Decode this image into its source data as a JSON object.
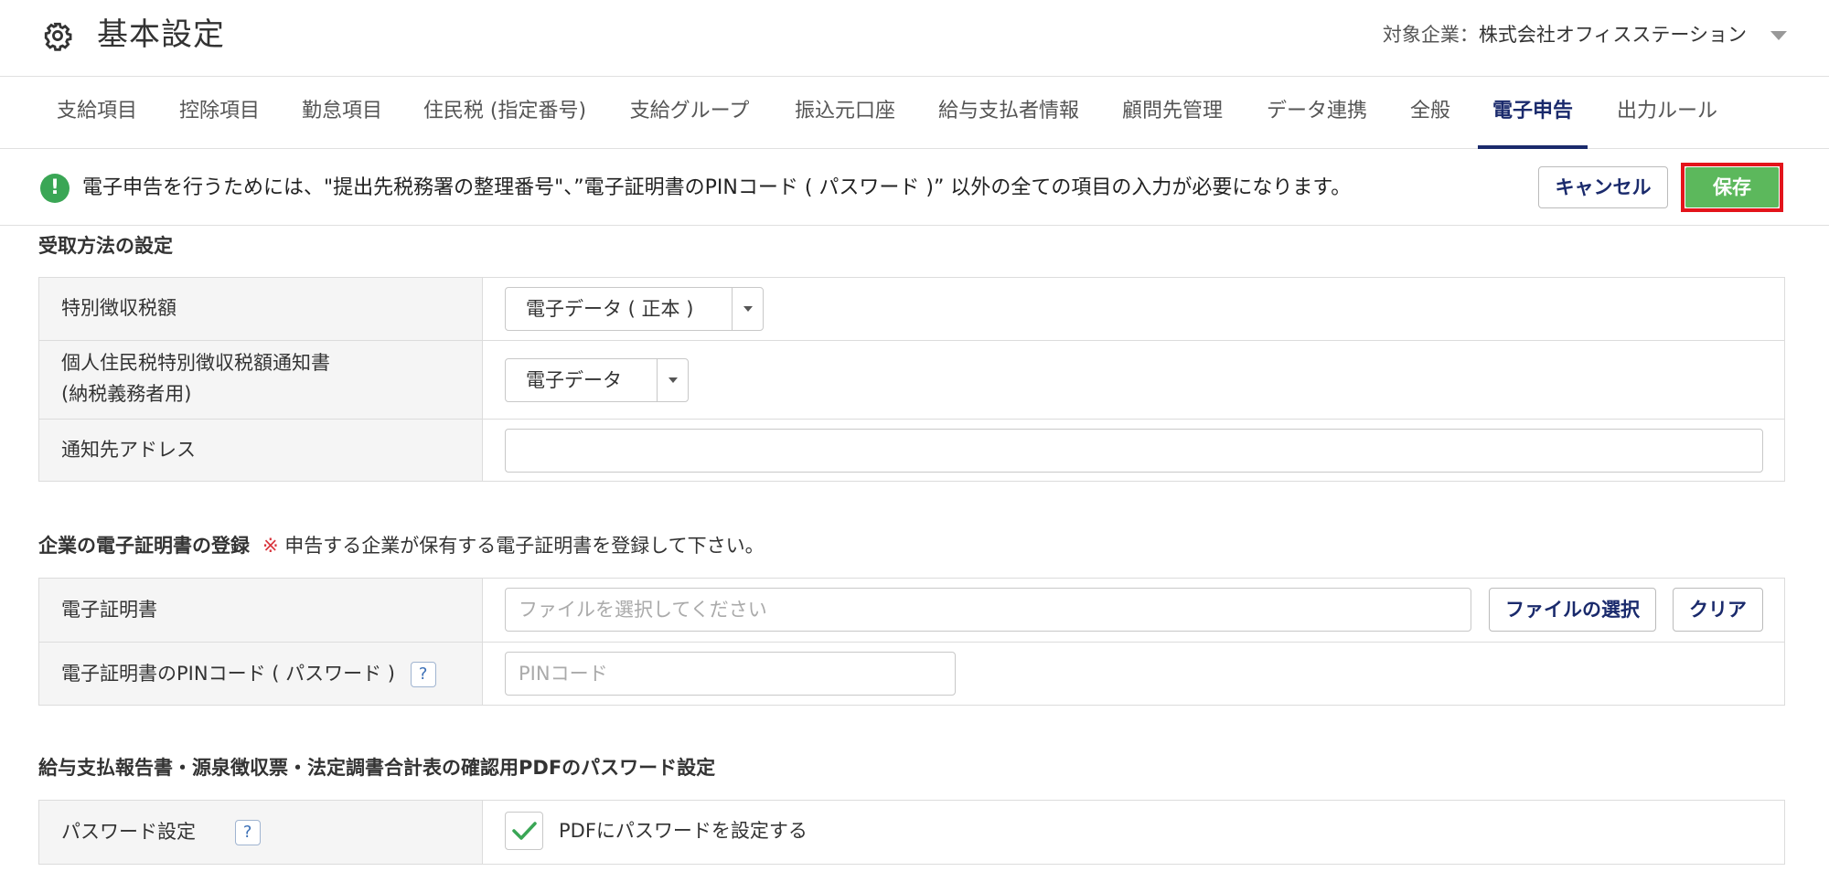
{
  "header": {
    "title": "基本設定",
    "company_label": "対象企業：",
    "company_name": "株式会社オフィスステーション"
  },
  "tabs": [
    {
      "label": "支給項目",
      "active": false
    },
    {
      "label": "控除項目",
      "active": false
    },
    {
      "label": "勤怠項目",
      "active": false
    },
    {
      "label": "住民税 (指定番号)",
      "active": false
    },
    {
      "label": "支給グループ",
      "active": false
    },
    {
      "label": "振込元口座",
      "active": false
    },
    {
      "label": "給与支払者情報",
      "active": false
    },
    {
      "label": "顧問先管理",
      "active": false
    },
    {
      "label": "データ連携",
      "active": false
    },
    {
      "label": "全般",
      "active": false
    },
    {
      "label": "電子申告",
      "active": true
    },
    {
      "label": "出力ルール",
      "active": false
    }
  ],
  "notice": {
    "text": "電子申告を行うためには、\"提出先税務署の整理番号\"、”電子証明書のPINコード ( パスワード )” 以外の全ての項目の入力が必要になります。",
    "cancel_label": "キャンセル",
    "save_label": "保存"
  },
  "receive_section": {
    "title": "受取方法の設定",
    "rows": {
      "special_tax": {
        "label": "特別徴収税額",
        "value": "電子データ ( 正本 )"
      },
      "notice_doc": {
        "label_line1": "個人住民税特別徴収税額通知書",
        "label_line2": "(納税義務者用)",
        "value": "電子データ"
      },
      "address": {
        "label": "通知先アドレス",
        "value": ""
      }
    }
  },
  "cert_section": {
    "title": "企業の電子証明書の登録",
    "note_mark": "※",
    "note": "申告する企業が保有する電子証明書を登録して下さい。",
    "cert": {
      "label": "電子証明書",
      "placeholder": "ファイルを選択してください",
      "choose_label": "ファイルの選択",
      "clear_label": "クリア"
    },
    "pin": {
      "label": "電子証明書のPINコード ( パスワード )",
      "help": "?",
      "placeholder": "PINコード"
    }
  },
  "pdf_section": {
    "title": "給与支払報告書・源泉徴収票・法定調書合計表の確認用PDFのパスワード設定",
    "password": {
      "label": "パスワード設定",
      "help": "?",
      "checkbox_label": "PDFにパスワードを設定する",
      "checked": true
    }
  },
  "colors": {
    "accent": "#1a2a6c",
    "save": "#5cb85c",
    "highlight": "#e3141b",
    "notice_icon": "#3aa655"
  }
}
